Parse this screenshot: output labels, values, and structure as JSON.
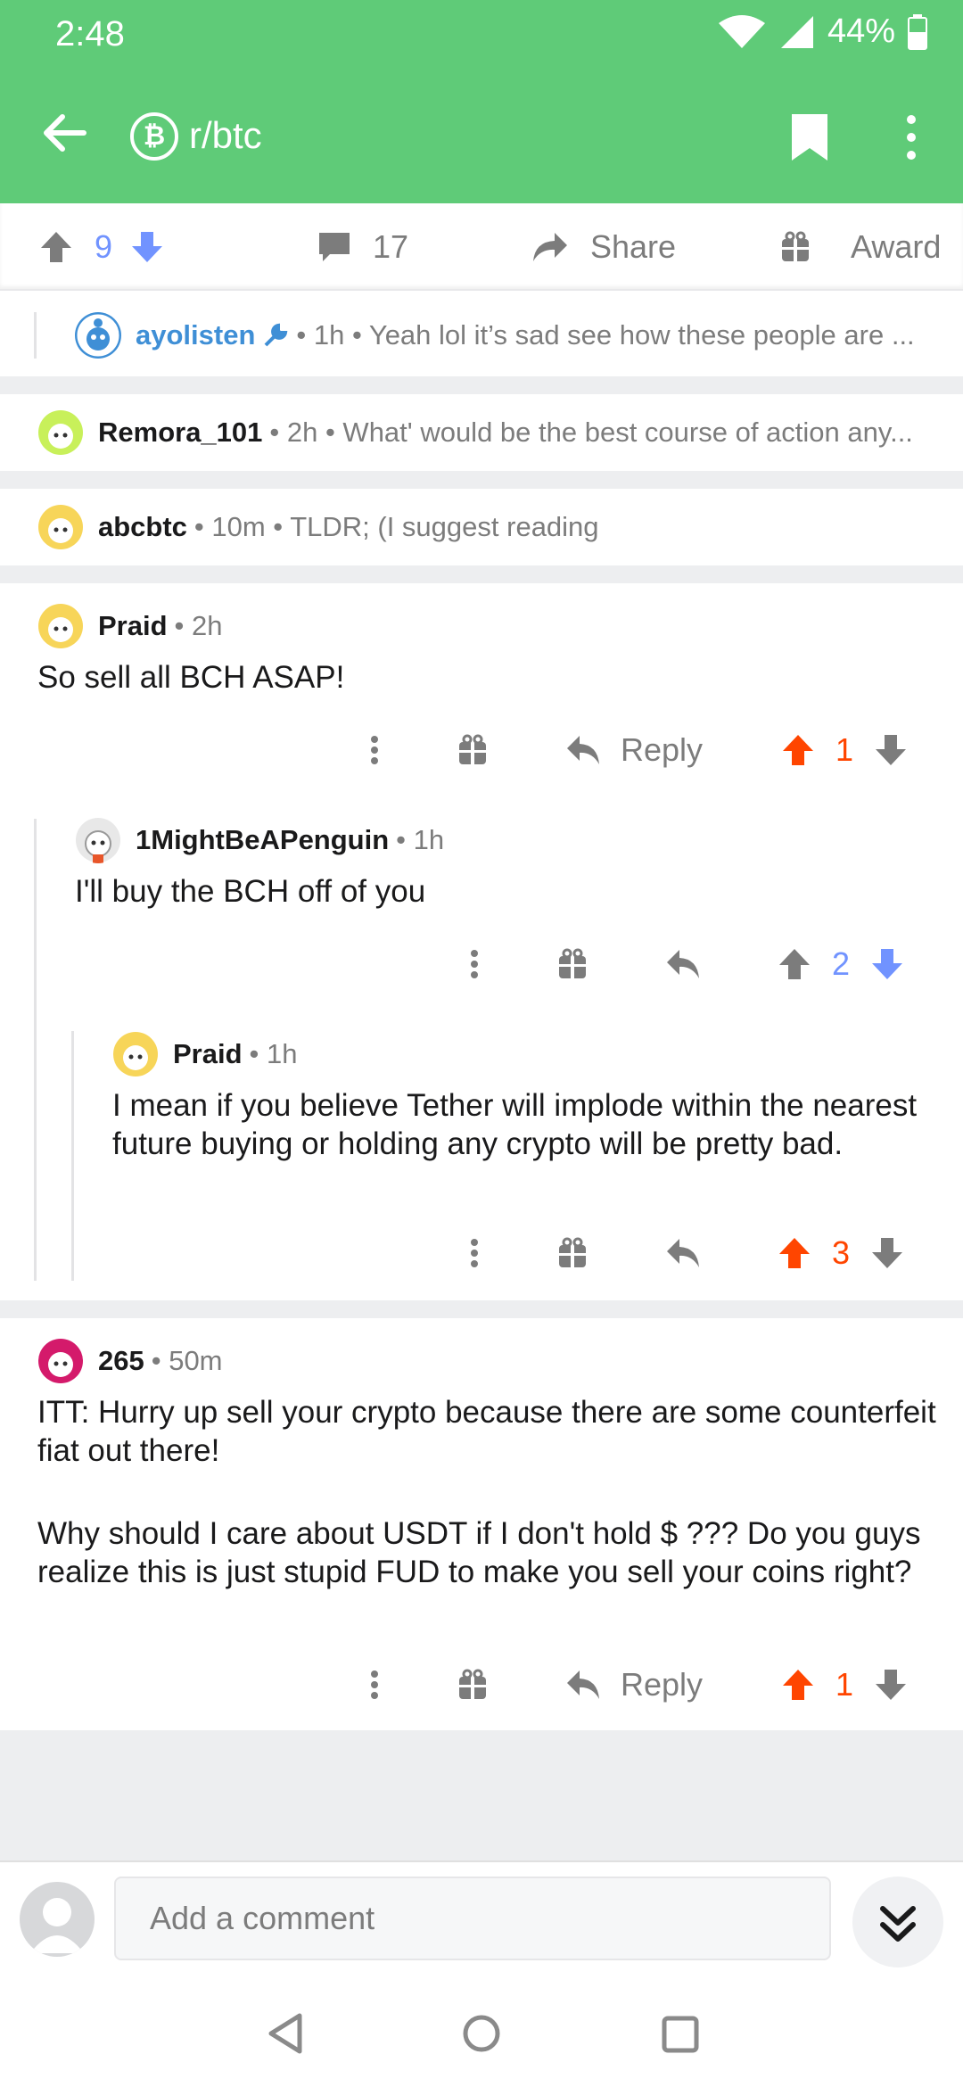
{
  "status": {
    "time": "2:48",
    "battery": "44%"
  },
  "header": {
    "subreddit": "r/btc",
    "sub_icon_glyph": "₿"
  },
  "post_actions": {
    "upvotes": "9",
    "comments": "17",
    "share_label": "Share",
    "award_label": "Award"
  },
  "collapsed": [
    {
      "user": "ayolisten",
      "meta": "• 1h • Yeah lol it’s sad see how these people are ..."
    },
    {
      "user": "Remora_101",
      "meta": "• 2h • What' would be the best course of action any..."
    },
    {
      "user": "abcbtc",
      "meta": "• 10m • TLDR; (I suggest reading"
    }
  ],
  "comments": [
    {
      "user": "Praid",
      "time": "• 2h",
      "body": "So sell all BCH ASAP!",
      "reply_label": "Reply",
      "votes": "1"
    },
    {
      "user": "1MightBeAPenguin",
      "time": "• 1h",
      "body": "I'll buy the BCH off of you",
      "votes": "2"
    },
    {
      "user": "Praid",
      "time": "• 1h",
      "body": "I mean if you believe Tether will implode within the nearest future buying or holding any crypto will be pretty bad.",
      "votes": "3"
    },
    {
      "user": "265",
      "time": "• 50m",
      "body_p1": "ITT: Hurry up sell your crypto because there are some counterfeit fiat out there!",
      "body_p2": "Why should I care about USDT if I don't hold $ ??? Do you guys realize this is just stupid FUD to make you sell your coins right?",
      "reply_label": "Reply",
      "votes": "1"
    }
  ],
  "composer": {
    "placeholder": "Add a comment"
  },
  "colors": {
    "header_green": "#5fcb78",
    "upvote_orange": "#ff4500",
    "downvote_blue": "#7193ff",
    "mod_blue": "#3f8fd6"
  }
}
